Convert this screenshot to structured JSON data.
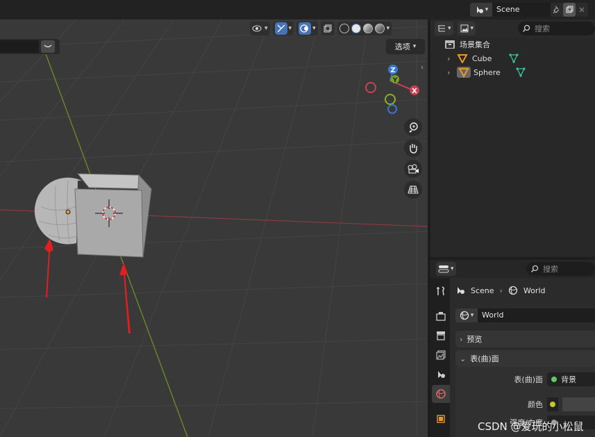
{
  "header": {
    "scene_name": "Scene"
  },
  "viewport": {
    "options_label": "选项",
    "axis_labels": {
      "z": "Z",
      "y": "Y",
      "x": "X"
    },
    "colors": {
      "x_axis": "#c74352",
      "y_axis": "#7a9e2a",
      "z_axis": "#3a76c9",
      "selection": "#e8e8e8"
    },
    "icons": [
      "visibility-icon",
      "gizmo-icon",
      "overlay-icon",
      "xray-icon",
      "wireframe-shading-icon",
      "solid-shading-icon",
      "material-shading-icon",
      "rendered-shading-icon",
      "zoom-icon",
      "hand-pan-icon",
      "camera-view-icon",
      "grid-ortho-icon"
    ]
  },
  "outliner": {
    "search_placeholder": "搜索",
    "collection_label": "场景集合",
    "items": [
      {
        "label": "Cube"
      },
      {
        "label": "Sphere"
      }
    ]
  },
  "properties": {
    "search_placeholder": "搜索",
    "breadcrumb": {
      "scene": "Scene",
      "world": "World"
    },
    "world_name": "World",
    "panels": {
      "preview": "预览",
      "surface": "表(曲)面"
    },
    "rows": {
      "surface_label": "表(曲)面",
      "surface_value": "背景",
      "color_label": "颜色",
      "strength_label": "强度/力度"
    },
    "colors": {
      "active_tab": "#3d3d3d",
      "socket_green": "#63c763",
      "socket_yellow": "#c7c729"
    }
  },
  "watermark": "CSDN @爱玩的小松鼠"
}
